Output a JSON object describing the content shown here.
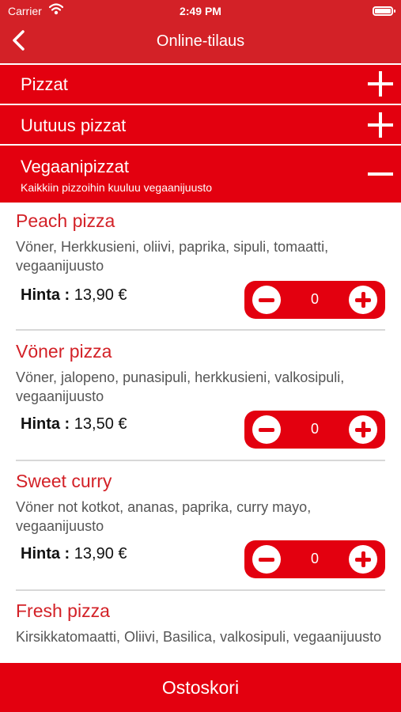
{
  "status_bar": {
    "carrier": "Carrier",
    "time": "2:49 PM"
  },
  "header": {
    "title": "Online-tilaus"
  },
  "categories": [
    {
      "name": "Pizzat",
      "expanded": false
    },
    {
      "name": "Uutuus pizzat",
      "expanded": false
    },
    {
      "name": "Vegaanipizzat",
      "subtitle": "Kaikkiin pizzoihin kuuluu vegaanijuusto",
      "expanded": true
    }
  ],
  "items": [
    {
      "name": "Peach pizza",
      "desc": "Vöner, Herkkusieni, oliivi, paprika, sipuli, tomaatti, vegaanijuusto",
      "price_label": "Hinta :",
      "price": "13,90 €",
      "qty": "0"
    },
    {
      "name": "Vöner pizza",
      "desc": "Vöner, jalopeno, punasipuli, herkkusieni, valkosipuli, vegaanijuusto",
      "price_label": "Hinta :",
      "price": "13,50 €",
      "qty": "0"
    },
    {
      "name": "Sweet curry",
      "desc": "Vöner not kotkot, ananas, paprika, curry mayo, vegaanijuusto",
      "price_label": "Hinta :",
      "price": "13,90 €",
      "qty": "0"
    },
    {
      "name": "Fresh pizza",
      "desc": "Kirsikkatomaatti, Oliivi, Basilica, valkosipuli, vegaanijuusto"
    }
  ],
  "footer": {
    "cart_label": "Ostoskori"
  },
  "colors": {
    "header": "#d32127",
    "accent": "#e3000f",
    "item_title": "#d32127"
  }
}
